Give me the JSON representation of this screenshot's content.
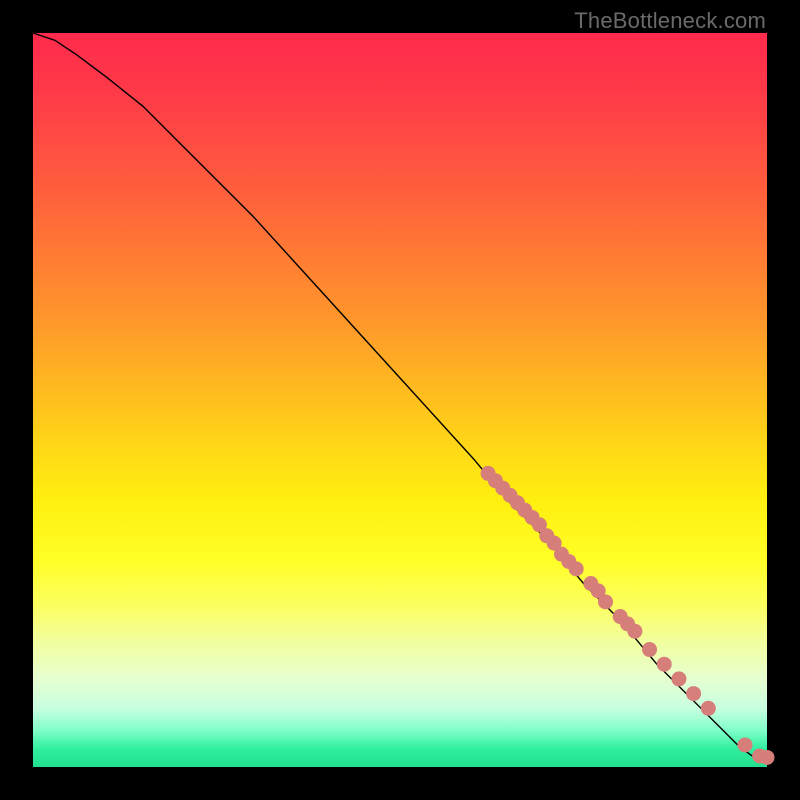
{
  "watermark": "TheBottleneck.com",
  "chart_data": {
    "type": "line",
    "title": "",
    "xlabel": "",
    "ylabel": "",
    "xlim": [
      0,
      100
    ],
    "ylim": [
      0,
      100
    ],
    "grid": false,
    "legend": false,
    "series": [
      {
        "name": "curve",
        "kind": "line",
        "color": "#000000",
        "x": [
          0,
          3,
          6,
          10,
          15,
          20,
          30,
          40,
          50,
          60,
          65,
          70,
          75,
          80,
          85,
          88,
          90,
          92,
          94,
          95,
          96,
          97,
          98,
          99,
          100
        ],
        "y": [
          100,
          99,
          97,
          94,
          90,
          85,
          75,
          64,
          53,
          42,
          36,
          31,
          25,
          20,
          14,
          11,
          9,
          7,
          5,
          4,
          3,
          2.2,
          1.5,
          1.1,
          1.3
        ]
      },
      {
        "name": "points",
        "kind": "scatter",
        "color": "#d67f7a",
        "x": [
          62,
          63,
          64,
          65,
          66,
          67,
          68,
          69,
          70,
          71,
          72,
          73,
          74,
          76,
          77,
          78,
          80,
          81,
          82,
          84,
          86,
          88,
          90,
          92,
          97,
          99,
          100
        ],
        "y": [
          40,
          39,
          38,
          37,
          36,
          35,
          34,
          33,
          31.5,
          30.5,
          29,
          28,
          27,
          25,
          24,
          22.5,
          20.5,
          19.5,
          18.5,
          16,
          14,
          12,
          10,
          8,
          3,
          1.5,
          1.3
        ]
      }
    ]
  }
}
